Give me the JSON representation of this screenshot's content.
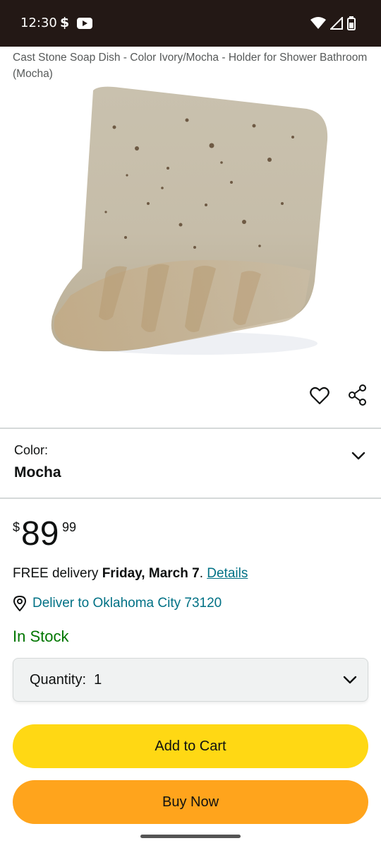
{
  "status_bar": {
    "time": "12:30",
    "app_icon_1": "dollar-sign",
    "app_icon_2": "youtube-icon",
    "right_icons": [
      "wifi-icon",
      "signal-icon",
      "battery-icon"
    ]
  },
  "product": {
    "title": "Cast Stone Soap Dish - Color Ivory/Mocha - Holder for Shower Bathroom (Mocha)",
    "image_alt": "Cast stone soap dish in mocha color"
  },
  "actions": {
    "favorite_icon": "heart-icon",
    "share_icon": "share-icon"
  },
  "variation": {
    "label": "Color:",
    "value": "Mocha"
  },
  "price": {
    "symbol": "$",
    "whole": "89",
    "fraction": "99"
  },
  "delivery": {
    "prefix": "FREE delivery ",
    "date": "Friday, March 7",
    "period": ". ",
    "details_link": "Details"
  },
  "location": {
    "text": "Deliver to Oklahoma City 73120"
  },
  "availability": {
    "text": "In Stock"
  },
  "quantity": {
    "label": "Quantity:",
    "value": "1"
  },
  "buttons": {
    "add_to_cart": "Add to Cart",
    "buy_now": "Buy Now"
  },
  "colors": {
    "add_to_cart_bg": "#FFD814",
    "buy_now_bg": "#FFA41C",
    "link": "#007185",
    "in_stock": "#007600",
    "status_bar_bg": "#231815"
  }
}
